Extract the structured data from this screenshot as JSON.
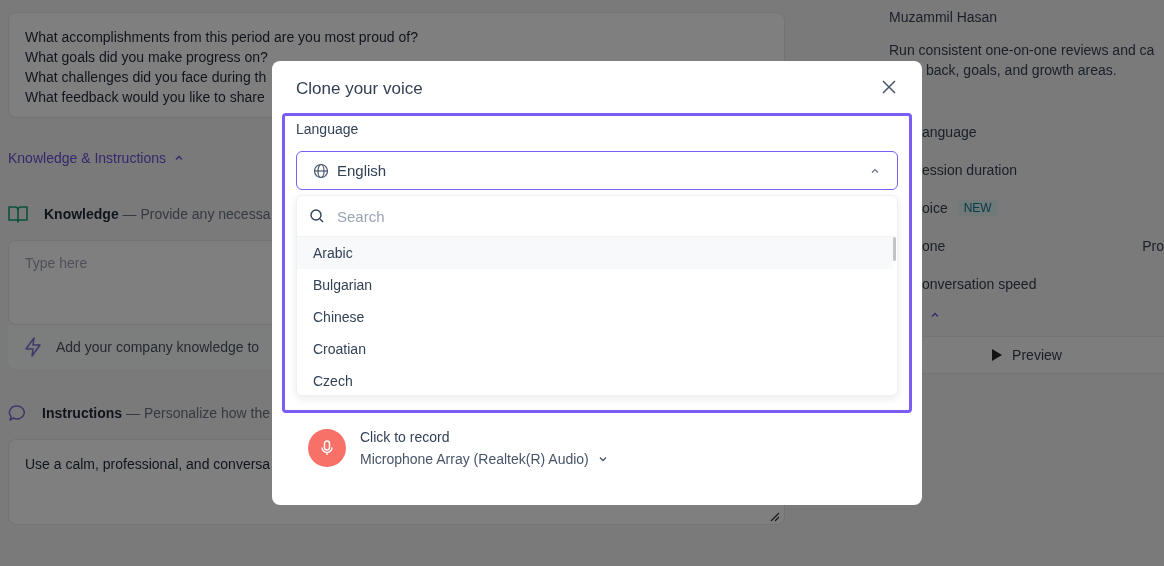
{
  "background": {
    "prompts": [
      "What accomplishments from this period are you most proud of?",
      "What goals did you make progress on?",
      "What challenges did you face during th",
      "What feedback would you like to share"
    ],
    "section_toggle": {
      "label": "Knowledge & Instructions",
      "expanded": true
    },
    "knowledge": {
      "title": "Knowledge",
      "description": " — Provide any necessa",
      "placeholder": "Type here",
      "hint": "Add your company knowledge to"
    },
    "instructions": {
      "title": "Instructions",
      "description": " — Personalize how the",
      "value": "Use a calm, professional, and conversa"
    },
    "right_panel": {
      "author": "Muzammil Hasan",
      "description_lines": [
        "Run consistent one-on-one reviews and ca",
        "back, goals, and growth areas."
      ],
      "settings": [
        {
          "label": "anguage"
        },
        {
          "label": "ession duration"
        },
        {
          "label": "oice",
          "badge": "NEW"
        },
        {
          "label": "one",
          "value": "Pro"
        },
        {
          "label": "onversation speed"
        }
      ],
      "preview_button": "Preview"
    }
  },
  "dialog": {
    "title": "Clone your voice",
    "language": {
      "label": "Language",
      "value": "English",
      "expanded": true,
      "search_placeholder": "Search",
      "options": [
        {
          "label": "Arabic",
          "highlighted": true
        },
        {
          "label": "Bulgarian",
          "highlighted": false
        },
        {
          "label": "Chinese",
          "highlighted": false
        },
        {
          "label": "Croatian",
          "highlighted": false
        },
        {
          "label": "Czech",
          "highlighted": false
        }
      ]
    },
    "record": {
      "label": "Click to record",
      "device": "Microphone Array (Realtek(R) Audio)"
    }
  }
}
